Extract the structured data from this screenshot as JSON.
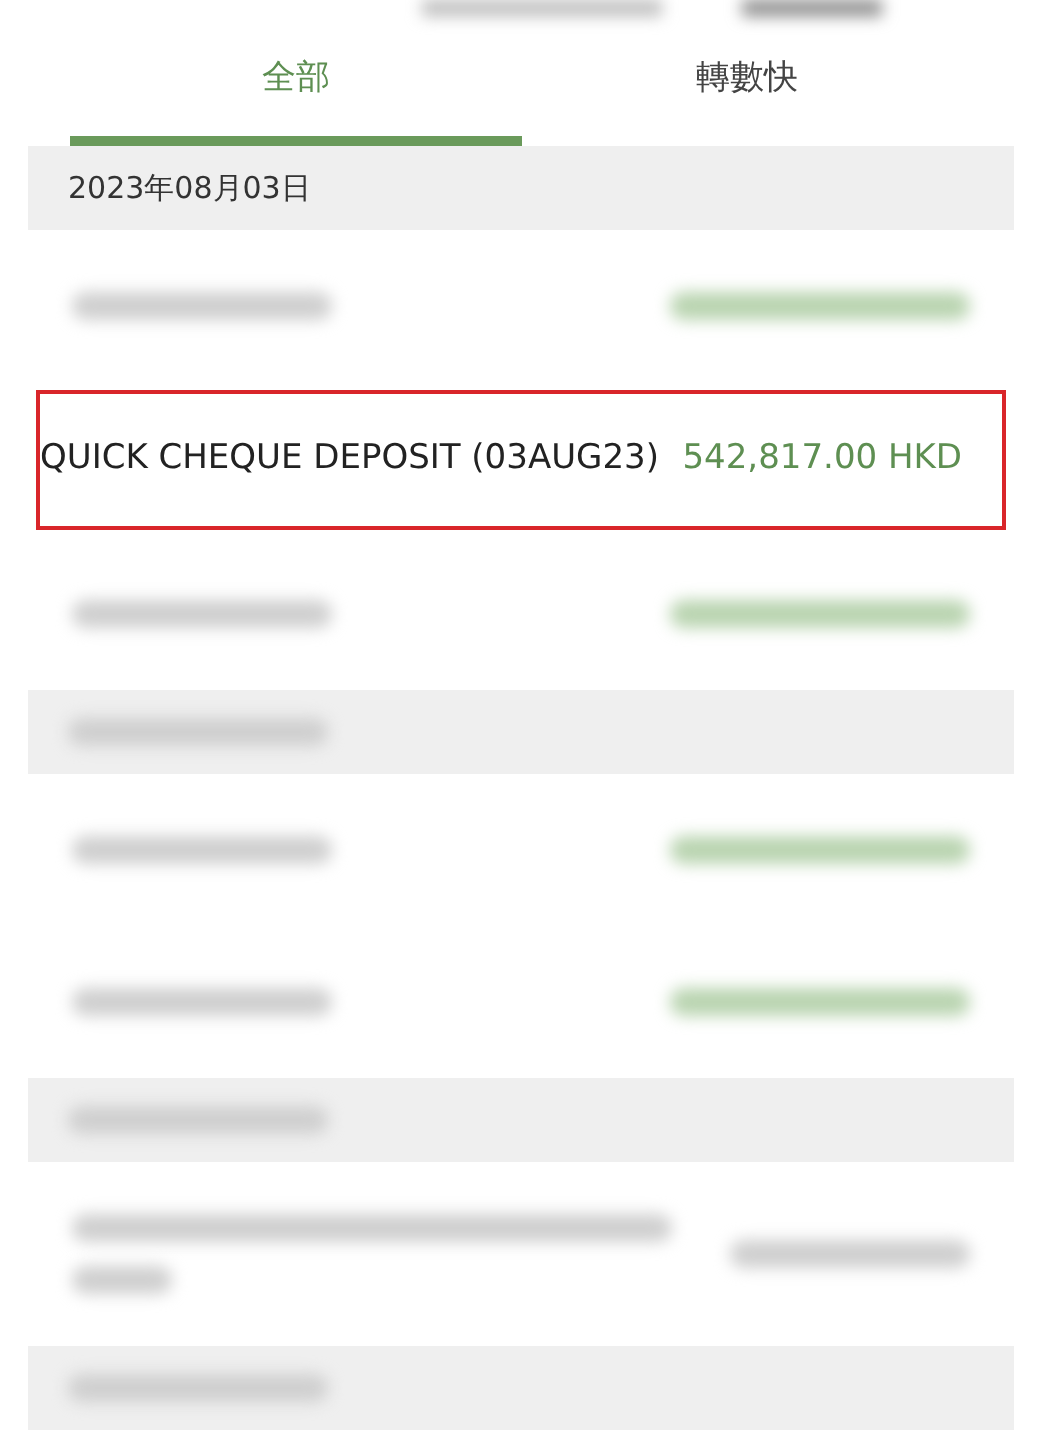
{
  "tabs": [
    {
      "label": "全部",
      "selected": true
    },
    {
      "label": "轉數快",
      "selected": false
    }
  ],
  "sections": [
    {
      "kind": "dated",
      "date": "2023年08月03日",
      "items": [
        {
          "kind": "blurred"
        },
        {
          "kind": "transaction",
          "description": "QUICK CHEQUE DEPOSIT (03AUG23)",
          "amount": "542,817.00 HKD",
          "highlighted": true
        },
        {
          "kind": "blurred"
        }
      ]
    },
    {
      "kind": "blurred",
      "items": [
        {
          "kind": "blurred"
        },
        {
          "kind": "blurred"
        }
      ]
    },
    {
      "kind": "blurred",
      "items": [
        {
          "kind": "blurred_two_line"
        }
      ]
    },
    {
      "kind": "blurred"
    }
  ]
}
